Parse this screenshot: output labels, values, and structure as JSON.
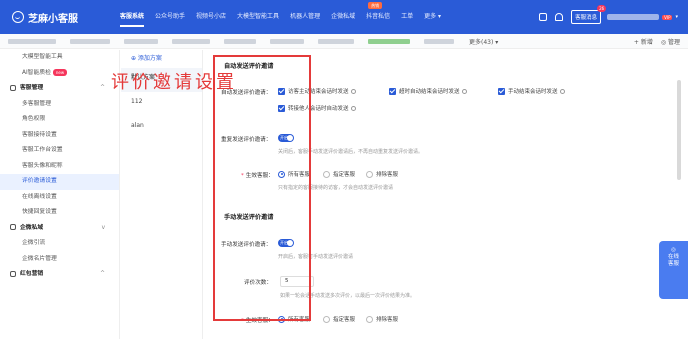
{
  "app": {
    "logo_text": "芝麻小客服"
  },
  "nav": [
    {
      "label": "客服系统",
      "active": true
    },
    {
      "label": "公众号助手"
    },
    {
      "label": "视频号小店"
    },
    {
      "label": "大模型智能工具"
    },
    {
      "label": "机器人管理"
    },
    {
      "label": "企微私域"
    },
    {
      "label": "抖音私信",
      "badge": "热销"
    },
    {
      "label": "工单"
    },
    {
      "label": "更多 ▾"
    }
  ],
  "top_right": {
    "msg_button": "客服消息",
    "msg_count": "26",
    "vip": "VIP",
    "caret": "▾"
  },
  "tabs": {
    "more": "更多(43) ▾",
    "add": "+ 新增",
    "manage": "◎ 管理"
  },
  "sidebar": [
    {
      "label": "大模型智能工具"
    },
    {
      "label": "AI智能质检",
      "badge": "new"
    },
    {
      "label": "客服管理",
      "group": true,
      "chev": "^"
    },
    {
      "label": "多客服管理"
    },
    {
      "label": "角色权限"
    },
    {
      "label": "客服接待设置"
    },
    {
      "label": "客服工作台设置"
    },
    {
      "label": "客服头像和昵称"
    },
    {
      "label": "评价邀请设置",
      "selected": true
    },
    {
      "label": "在线离线设置"
    },
    {
      "label": "快捷回复设置"
    },
    {
      "label": "企微私域",
      "group": true,
      "chev": "v"
    },
    {
      "label": "企微引流"
    },
    {
      "label": "企微名片管理"
    },
    {
      "label": "红包营销",
      "group": true,
      "chev": "^"
    }
  ],
  "plans": {
    "add": "⊕ 添加方案",
    "items": [
      "默认方案",
      "112",
      "alan"
    ]
  },
  "auto": {
    "title": "自动发送评价邀请",
    "label": "自动发送评价邀请：",
    "opt1": "访客主动结束会话时发送",
    "opt2": "超时自动结束会话时发送",
    "opt3": "手动结束会话时发送",
    "opt4": "转接他人会话时自动发送"
  },
  "repeat": {
    "label": "重复发送评价邀请：",
    "toggle": "开启",
    "hint": "关闭后，客服手动发送评价邀请后，不再自动重复发送评价邀请。"
  },
  "scope1": {
    "label": "生效客服：",
    "opt_all": "所有客服",
    "opt_specific": "指定客服",
    "opt_exclude": "排除客服",
    "hint": "只有指定的客服接待的访客，才会自动发送评价邀请"
  },
  "manual": {
    "title": "手动发送评价邀请",
    "label": "手动发送评价邀请：",
    "toggle": "开启",
    "hint": "开启后，客服可手动发送评价邀请",
    "times_label": "评价次数：",
    "times_value": "5",
    "times_hint": "如果一轮会话手动发送多次评价，以最后一次评价结果为准。",
    "scope_label": "生效客服：",
    "opt_all": "所有客服",
    "opt_specific": "指定客服",
    "opt_exclude": "排除客服"
  },
  "overlay_title": "评价邀请设置",
  "float_panel": {
    "line1": "◎",
    "line2": "在线",
    "line3": "客服"
  },
  "colors": {
    "brand": "#2a5bd7",
    "highlight": "#e43a3a"
  }
}
